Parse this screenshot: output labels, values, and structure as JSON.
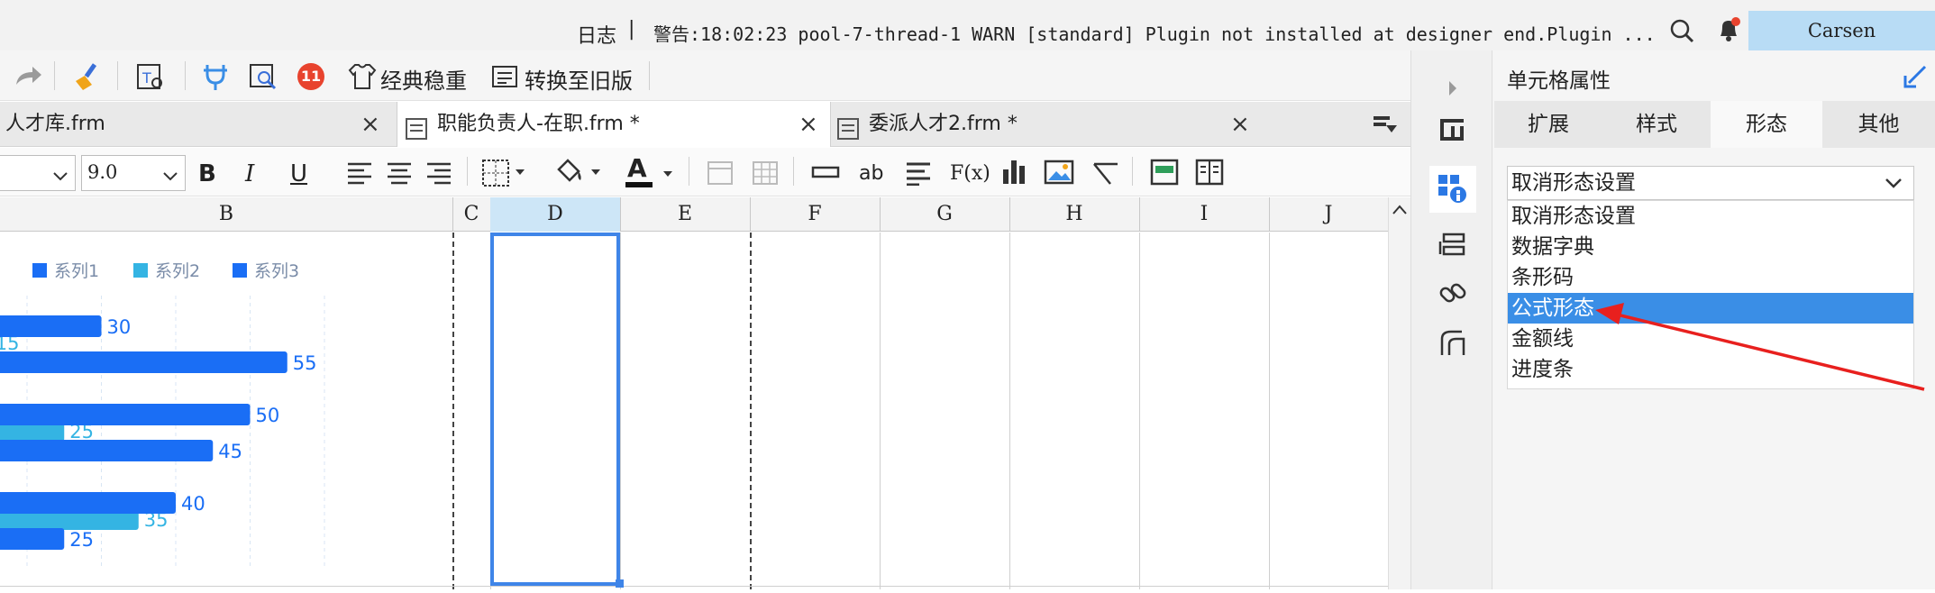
{
  "top": {
    "log_label": "日志",
    "separator": "|",
    "warning": "警告:18:02:23 pool-7-thread-1 WARN [standard] Plugin not installed at designer end.Plugin ...",
    "user": "Carsen"
  },
  "toolbar": {
    "badge_count": "11",
    "classic_label": "经典稳重",
    "convert_label": "转换至旧版"
  },
  "tabs": [
    {
      "label": "人才库.frm"
    },
    {
      "label": "职能负责人-在职.frm *"
    },
    {
      "label": "委派人才2.frm *"
    }
  ],
  "tab_close": "×",
  "format": {
    "font_size": "9.0",
    "bold": "B",
    "italic": "I",
    "underline": "U",
    "font_color_letter": "A",
    "text_ab": "ab",
    "formula": "F(x)"
  },
  "columns": [
    "B",
    "C",
    "D",
    "E",
    "F",
    "G",
    "H",
    "I",
    "J"
  ],
  "colors": {
    "series1": "#1a6ef5",
    "series2": "#34b4e3",
    "series3": "#1a6ef5",
    "selection": "#3f85e8",
    "highlight": "#3a8ee6",
    "annotation": "#e8201e"
  },
  "chart_data": {
    "type": "bar",
    "orientation": "horizontal",
    "legend": [
      "系列1",
      "系列2",
      "系列3"
    ],
    "legend_position": "top",
    "series": [
      {
        "name": "系列1",
        "values": [
          30,
          50,
          40
        ]
      },
      {
        "name": "系列2",
        "values": [
          15,
          25,
          35
        ]
      },
      {
        "name": "系列3",
        "values": [
          55,
          45,
          25
        ]
      }
    ],
    "xlim": [
      0,
      60
    ],
    "grid": true
  },
  "panel": {
    "title": "单元格属性",
    "tabs": [
      "扩展",
      "样式",
      "形态",
      "其他"
    ],
    "active_tab": 2,
    "select_value": "取消形态设置",
    "options": [
      "取消形态设置",
      "数据字典",
      "条形码",
      "公式形态",
      "金额线",
      "进度条"
    ],
    "highlighted_option": 3
  }
}
